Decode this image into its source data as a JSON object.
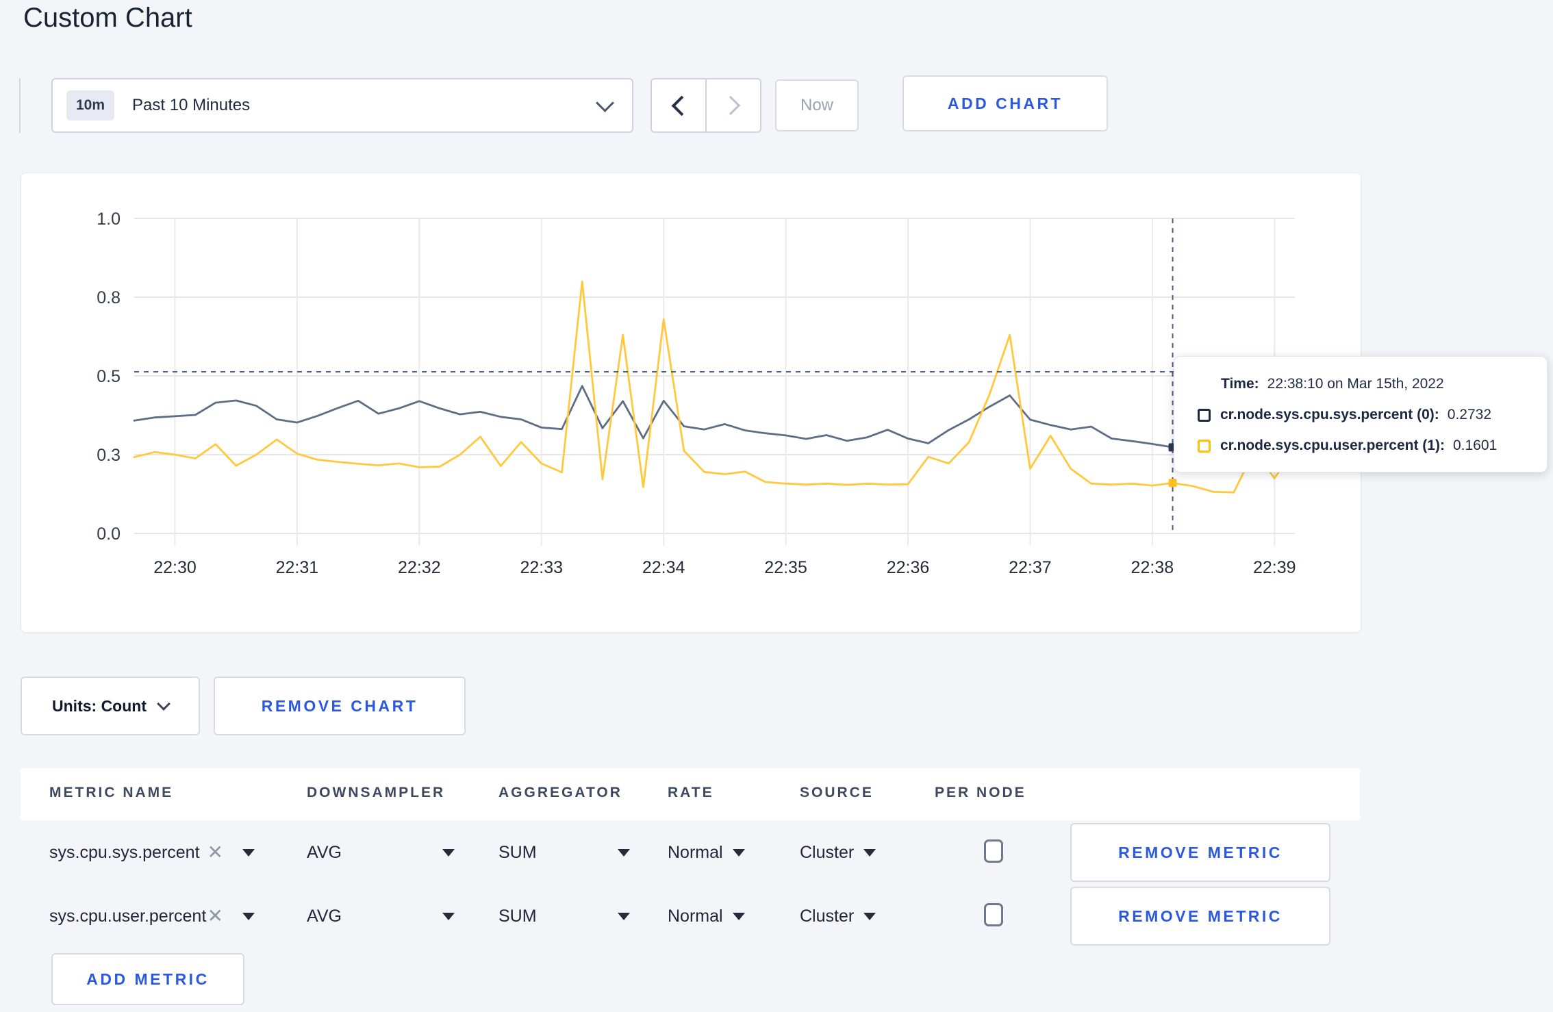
{
  "page": {
    "title": "Custom Chart"
  },
  "toolbar": {
    "time_badge": "10m",
    "time_label": "Past 10 Minutes",
    "now_label": "Now",
    "add_chart_label": "ADD CHART",
    "accent_blue": "#2a59e0"
  },
  "tooltip": {
    "time_label": "Time:",
    "time_value": "22:38:10 on Mar 15th, 2022",
    "rows": [
      {
        "name": "cr.node.sys.cpu.sys.percent (0):",
        "value": "0.2732",
        "swatch_color": "#1e2a45"
      },
      {
        "name": "cr.node.sys.cpu.user.percent (1):",
        "value": "0.1601",
        "swatch_color": "#ffc20a"
      }
    ]
  },
  "units_bar": {
    "units_label": "Units: Count",
    "remove_chart_label": "REMOVE CHART"
  },
  "metrics_table": {
    "headers": [
      "METRIC NAME",
      "DOWNSAMPLER",
      "AGGREGATOR",
      "RATE",
      "SOURCE",
      "PER NODE"
    ],
    "rows": [
      {
        "metric": "sys.cpu.sys.percent",
        "downsampler": "AVG",
        "aggregator": "SUM",
        "rate": "Normal",
        "source": "Cluster",
        "per_node_checked": false,
        "remove_label": "REMOVE METRIC"
      },
      {
        "metric": "sys.cpu.user.percent",
        "downsampler": "AVG",
        "aggregator": "SUM",
        "rate": "Normal",
        "source": "Cluster",
        "per_node_checked": false,
        "remove_label": "REMOVE METRIC"
      }
    ],
    "add_metric_label": "ADD METRIC"
  },
  "chart_data": {
    "type": "line",
    "title": "",
    "xlabel": "",
    "ylabel": "",
    "ylim": [
      0,
      1
    ],
    "grid": true,
    "y_ticks": [
      {
        "v": 0.0,
        "label": "0.0"
      },
      {
        "v": 0.25,
        "label": "0.3"
      },
      {
        "v": 0.5,
        "label": "0.5"
      },
      {
        "v": 0.75,
        "label": "0.8"
      },
      {
        "v": 1.0,
        "label": "1.0"
      }
    ],
    "x_domain_s": [
      0,
      570
    ],
    "sample_interval_s": 10,
    "x_start_time": "22:29:40",
    "x_tick_times_s": [
      20,
      80,
      140,
      200,
      260,
      320,
      380,
      440,
      500,
      560
    ],
    "x_tick_labels": [
      "22:30",
      "22:31",
      "22:32",
      "22:33",
      "22:34",
      "22:35",
      "22:36",
      "22:37",
      "22:38",
      "22:39"
    ],
    "series": [
      {
        "name": "cr.node.sys.cpu.sys.percent",
        "color": "#5e6c86",
        "dot_color": "#2a3852",
        "hover_value": 0.2732,
        "values": [
          0.358,
          0.368,
          0.372,
          0.376,
          0.415,
          0.422,
          0.405,
          0.362,
          0.352,
          0.373,
          0.398,
          0.421,
          0.38,
          0.397,
          0.42,
          0.397,
          0.378,
          0.386,
          0.37,
          0.362,
          0.336,
          0.331,
          0.468,
          0.334,
          0.42,
          0.302,
          0.421,
          0.34,
          0.33,
          0.347,
          0.327,
          0.318,
          0.311,
          0.3,
          0.312,
          0.294,
          0.305,
          0.329,
          0.301,
          0.286,
          0.328,
          0.362,
          0.402,
          0.438,
          0.361,
          0.344,
          0.33,
          0.339,
          0.301,
          0.293,
          0.284,
          0.2732,
          0.286,
          0.3,
          0.312,
          0.3,
          0.296,
          0.301
        ]
      },
      {
        "name": "cr.node.sys.cpu.user.percent",
        "color": "#ffc83d",
        "dot_color": "#ffc020",
        "hover_value": 0.1601,
        "values": [
          0.242,
          0.258,
          0.25,
          0.238,
          0.283,
          0.215,
          0.25,
          0.298,
          0.253,
          0.234,
          0.227,
          0.221,
          0.216,
          0.222,
          0.21,
          0.212,
          0.25,
          0.307,
          0.214,
          0.29,
          0.222,
          0.194,
          0.8,
          0.172,
          0.63,
          0.147,
          0.68,
          0.262,
          0.195,
          0.188,
          0.196,
          0.163,
          0.158,
          0.155,
          0.158,
          0.154,
          0.158,
          0.155,
          0.156,
          0.243,
          0.222,
          0.29,
          0.44,
          0.63,
          0.205,
          0.31,
          0.205,
          0.158,
          0.155,
          0.158,
          0.152,
          0.1601,
          0.15,
          0.132,
          0.13,
          0.262,
          0.175,
          0.27
        ]
      }
    ],
    "crosshair": {
      "time_s": 510,
      "time_label": "22:38:10",
      "y_value": 0.513
    },
    "legend_position": "tooltip-overlay"
  }
}
